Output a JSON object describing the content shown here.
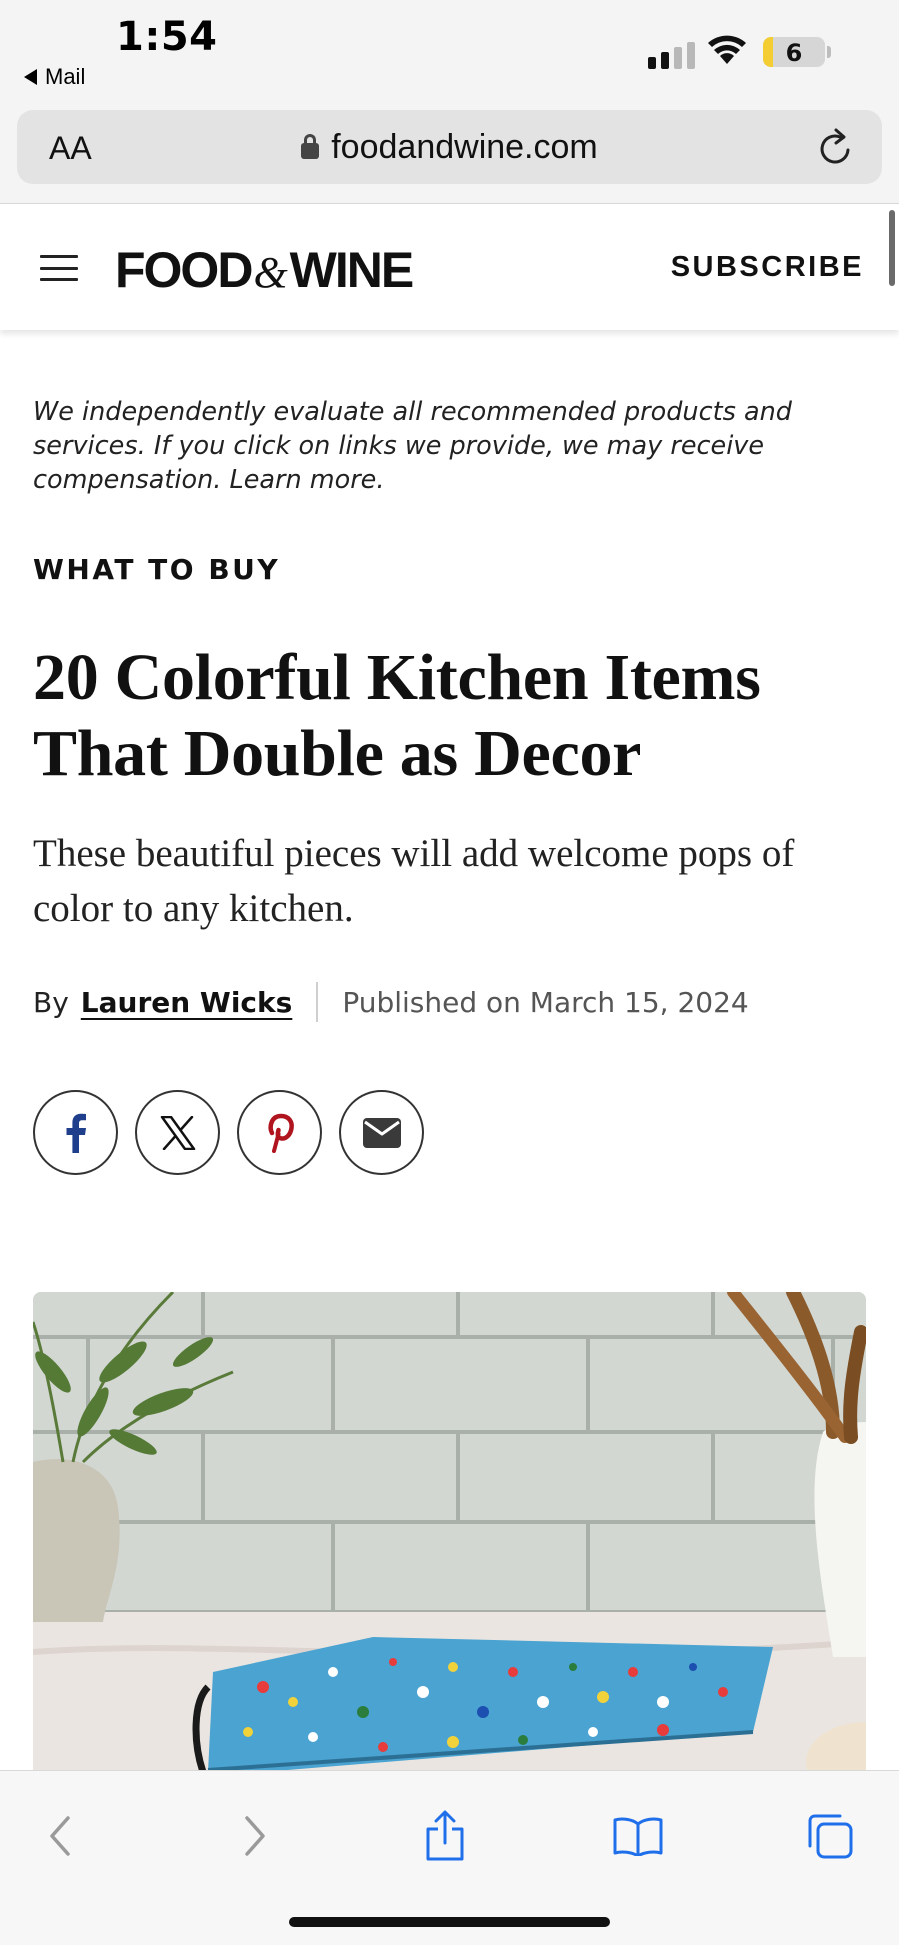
{
  "status_bar": {
    "time": "1:54",
    "back_app": "Mail",
    "battery_level": "6",
    "signal_bars_active": 2,
    "icons": [
      "cellular-signal-icon",
      "wifi-icon",
      "battery-icon"
    ]
  },
  "browser": {
    "text_size_label": "AA",
    "url": "foodandwine.com",
    "icons": [
      "lock-icon",
      "reload-icon"
    ]
  },
  "site_header": {
    "logo_left": "FOOD",
    "logo_amp": "&",
    "logo_right": "WINE",
    "subscribe": "SUBSCRIBE",
    "icons": [
      "hamburger-menu-icon"
    ]
  },
  "article": {
    "disclaimer": "We independently evaluate all recommended products and services. If you click on links we provide, we may receive compensation.",
    "disclaimer_link": "Learn more.",
    "eyebrow": "WHAT TO BUY",
    "headline": "20 Colorful Kitchen Items That Double as Decor",
    "subheading": "These beautiful pieces will add welcome pops of color to any kitchen.",
    "byline_prefix": "By",
    "author": "Lauren Wicks",
    "published": "Published on March 15, 2024"
  },
  "share": {
    "buttons": [
      "facebook-icon",
      "x-icon",
      "pinterest-icon",
      "email-icon"
    ]
  },
  "hero_image": {
    "description_name": "colorful-terrazzo-cutting-board-photo"
  },
  "toolbar": {
    "icons": [
      "back-icon",
      "forward-icon",
      "share-icon",
      "bookmarks-icon",
      "tabs-icon"
    ]
  },
  "colors": {
    "status_bg": "#f4f4f4",
    "address_bg": "#e3e3e3",
    "facebook": "#1f3f8c",
    "pinterest": "#b0141f",
    "safari_blue": "#1f6feb",
    "battery_low": "#f3cd32"
  }
}
